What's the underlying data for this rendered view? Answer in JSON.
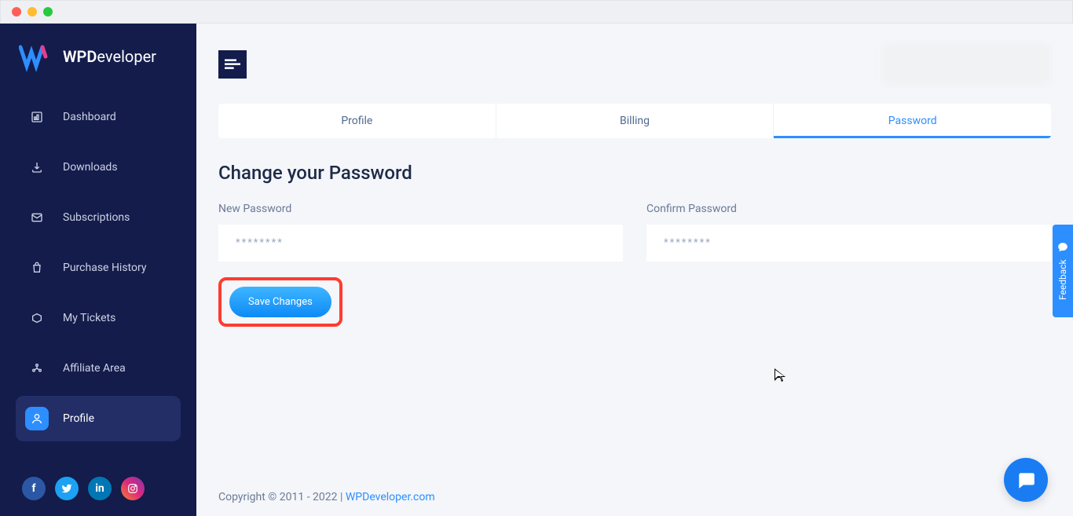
{
  "brand": {
    "name_bold": "WPD",
    "name_light": "eveloper"
  },
  "sidebar": {
    "items": [
      {
        "label": "Dashboard"
      },
      {
        "label": "Downloads"
      },
      {
        "label": "Subscriptions"
      },
      {
        "label": "Purchase History"
      },
      {
        "label": "My Tickets"
      },
      {
        "label": "Affiliate Area"
      },
      {
        "label": "Profile"
      }
    ]
  },
  "tabs": {
    "profile": "Profile",
    "billing": "Billing",
    "password": "Password"
  },
  "page": {
    "title": "Change your Password",
    "new_password_label": "New Password",
    "confirm_password_label": "Confirm Password",
    "placeholder": "********",
    "save_label": "Save Changes"
  },
  "footer": {
    "copyright_prefix": "Copyright © 2011 - 2022 | ",
    "link_text": "WPDeveloper.com"
  },
  "feedback": {
    "label": "Feedback"
  }
}
